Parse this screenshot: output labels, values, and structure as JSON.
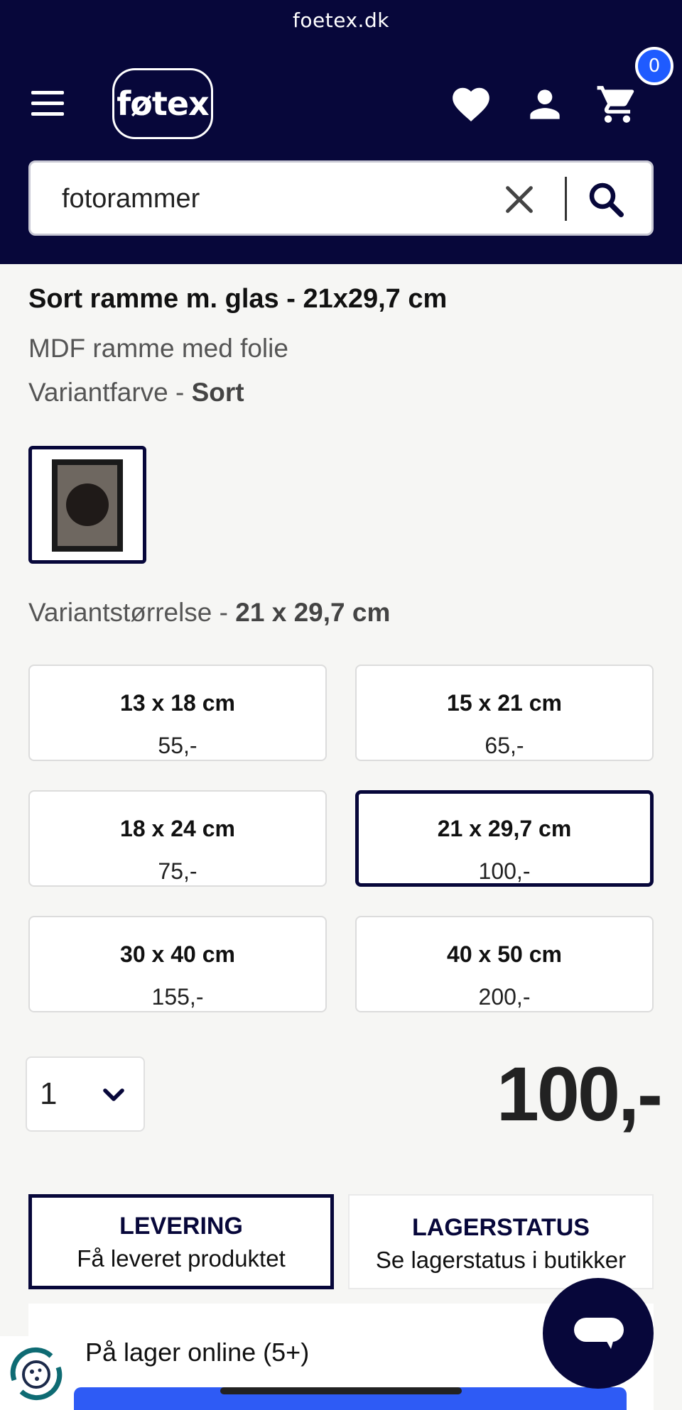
{
  "browser": {
    "url": "foetex.dk"
  },
  "header": {
    "logo": "føtex",
    "cart_count": "0",
    "icons": [
      "menu-icon",
      "heart-icon",
      "user-icon",
      "cart-icon"
    ]
  },
  "search": {
    "value": "fotorammer"
  },
  "product": {
    "title": "Sort ramme m. glas - 21x29,7 cm",
    "description": "MDF ramme med folie",
    "color_label": "Variantfarve - ",
    "color_value": "Sort",
    "size_label": "Variantstørrelse - ",
    "size_value": "21 x 29,7 cm"
  },
  "sizes": [
    {
      "size": "13 x 18 cm",
      "price": "55,-"
    },
    {
      "size": "15 x 21 cm",
      "price": "65,-"
    },
    {
      "size": "18 x 24 cm",
      "price": "75,-"
    },
    {
      "size": "21 x 29,7 cm",
      "price": "100,-",
      "selected": true
    },
    {
      "size": "30 x 40 cm",
      "price": "155,-"
    },
    {
      "size": "40 x 50 cm",
      "price": "200,-"
    }
  ],
  "quantity": "1",
  "price": "100,-",
  "tabs": [
    {
      "heading": "LEVERING",
      "description": "Få leveret produktet",
      "active": true
    },
    {
      "heading": "LAGERSTATUS",
      "description": "Se lagerstatus i butikker",
      "active": false
    }
  ],
  "stock": {
    "text": "På lager online (5+)"
  },
  "colors": {
    "navy": "#07073a",
    "accent_blue": "#1f5bff",
    "button_blue": "#2e5bf5"
  }
}
